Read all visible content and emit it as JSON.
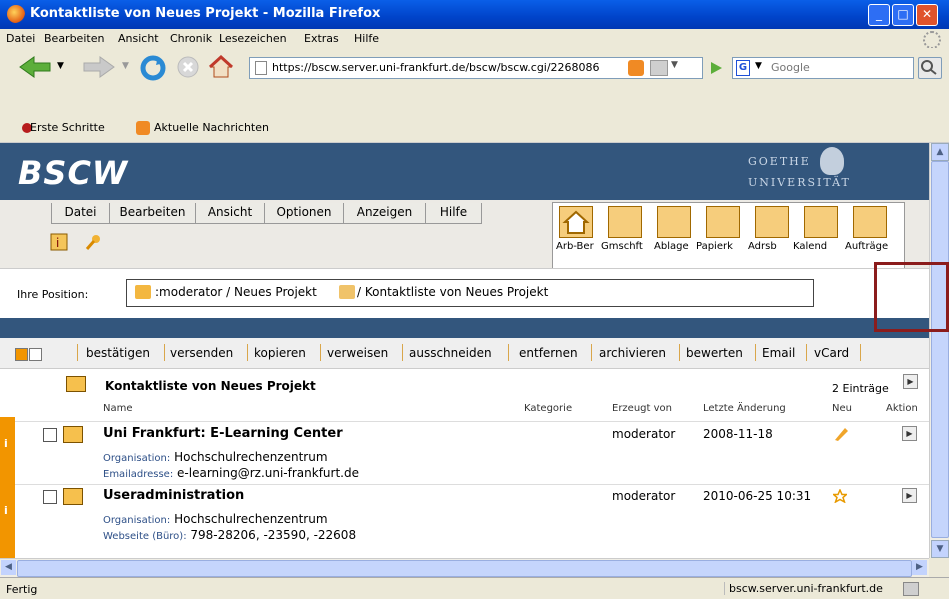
{
  "window": {
    "title": "Kontaktliste von Neues Projekt - Mozilla Firefox",
    "buttons": [
      "minimize",
      "maximize",
      "close"
    ]
  },
  "menubar": {
    "items": [
      "Datei",
      "Bearbeiten",
      "Ansicht",
      "Chronik",
      "Lesezeichen",
      "Extras",
      "Hilfe"
    ]
  },
  "navbar": {
    "url": "https://bscw.server.uni-frankfurt.de/bscw/bscw.cgi/2268086",
    "search_placeholder": "Google"
  },
  "bookmarks": {
    "items": [
      "Erste Schritte",
      "Aktuelle Nachrichten"
    ]
  },
  "bscw": {
    "logo": "BSCW",
    "university_line1": "GOETHE",
    "university_line2": "UNIVERSITÄT",
    "menu": [
      "Datei",
      "Bearbeiten",
      "Ansicht",
      "Optionen",
      "Anzeigen",
      "Hilfe"
    ],
    "nav_tiles": [
      "Arb-Ber",
      "Gmschft",
      "Ablage",
      "Papierk",
      "Adrsb",
      "Kalend",
      "Aufträge"
    ],
    "position_label": "Ihre Position:",
    "position_path_1": ":moderator / Neues Projekt",
    "position_path_2": "/ Kontaktliste von Neues Projekt"
  },
  "actions": [
    "bestätigen",
    "versenden",
    "kopieren",
    "verweisen",
    "ausschneiden",
    "entfernen",
    "archivieren",
    "bewerten",
    "Email",
    "vCard"
  ],
  "list": {
    "title": "Kontaktliste von Neues Projekt",
    "count": "2 Einträge",
    "columns": [
      "Name",
      "Kategorie",
      "Erzeugt von",
      "Letzte Änderung",
      "Neu",
      "Aktion"
    ],
    "rows": [
      {
        "name": "Uni Frankfurt: E-Learning Center",
        "created_by": "moderator",
        "modified": "2008-11-18",
        "detail1_key": "Organisation:",
        "detail1_val": "Hochschulrechenzentrum",
        "detail2_key": "Emailadresse:",
        "detail2_val": "e-learning@rz.uni-frankfurt.de"
      },
      {
        "name": "Useradministration",
        "created_by": "moderator",
        "modified": "2010-06-25 10:31",
        "detail1_key": "Organisation:",
        "detail1_val": "Hochschulrechenzentrum",
        "detail2_key": "Webseite (Büro):",
        "detail2_val": "798-28206, -23590, -22608"
      }
    ]
  },
  "status": {
    "text": "Fertig",
    "host": "bscw.server.uni-frankfurt.de"
  },
  "colors": {
    "bscw_blue": "#33567d",
    "accent_orange": "#f29500",
    "highlight_red": "#8b1c1c"
  }
}
